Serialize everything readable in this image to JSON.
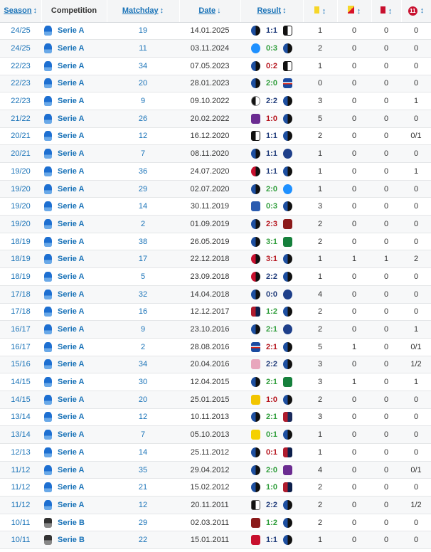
{
  "header": {
    "season": "Season",
    "competition": "Competition",
    "matchday": "Matchday",
    "date": "Date",
    "result": "Result",
    "sort_arrow": "↕",
    "sort_desc_arrow": "↓",
    "penalty_icon_label": "11"
  },
  "colors": {
    "link": "#1a73b8",
    "win": "#2e9d3a",
    "draw": "#1f3b7a",
    "loss": "#b5121b"
  },
  "rows": [
    {
      "season": "24/25",
      "competition": "Serie A",
      "matchday": "19",
      "date": "14.01.2025",
      "home": "atalanta-crest",
      "score": "1:1",
      "away": "juventus-crest",
      "outcome": "draw",
      "yellow": "1",
      "yellowred": "0",
      "red": "0",
      "penalties": "0"
    },
    {
      "season": "24/25",
      "competition": "Serie A",
      "matchday": "11",
      "date": "03.11.2024",
      "home": "napoli-crest",
      "score": "0:3",
      "away": "atalanta-crest",
      "outcome": "win",
      "yellow": "2",
      "yellowred": "0",
      "red": "0",
      "penalties": "0"
    },
    {
      "season": "22/23",
      "competition": "Serie A",
      "matchday": "34",
      "date": "07.05.2023",
      "home": "atalanta-crest",
      "score": "0:2",
      "away": "juventus-crest",
      "outcome": "loss",
      "yellow": "1",
      "yellowred": "0",
      "red": "0",
      "penalties": "0"
    },
    {
      "season": "22/23",
      "competition": "Serie A",
      "matchday": "20",
      "date": "28.01.2023",
      "home": "atalanta-crest",
      "score": "2:0",
      "away": "sampdoria-crest",
      "outcome": "win",
      "yellow": "0",
      "yellowred": "0",
      "red": "0",
      "penalties": "0"
    },
    {
      "season": "22/23",
      "competition": "Serie A",
      "matchday": "9",
      "date": "09.10.2022",
      "home": "udinese-crest",
      "score": "2:2",
      "away": "atalanta-crest",
      "outcome": "draw",
      "yellow": "3",
      "yellowred": "0",
      "red": "0",
      "penalties": "1"
    },
    {
      "season": "21/22",
      "competition": "Serie A",
      "matchday": "26",
      "date": "20.02.2022",
      "home": "fiorentina-crest",
      "score": "1:0",
      "away": "atalanta-crest",
      "outcome": "loss",
      "yellow": "5",
      "yellowred": "0",
      "red": "0",
      "penalties": "0"
    },
    {
      "season": "20/21",
      "competition": "Serie A",
      "matchday": "12",
      "date": "16.12.2020",
      "home": "juventus-crest",
      "score": "1:1",
      "away": "atalanta-crest",
      "outcome": "draw",
      "yellow": "2",
      "yellowred": "0",
      "red": "0",
      "penalties": "0/1"
    },
    {
      "season": "20/21",
      "competition": "Serie A",
      "matchday": "7",
      "date": "08.11.2020",
      "home": "atalanta-crest",
      "score": "1:1",
      "away": "inter-crest",
      "outcome": "draw",
      "yellow": "1",
      "yellowred": "0",
      "red": "0",
      "penalties": "0"
    },
    {
      "season": "19/20",
      "competition": "Serie A",
      "matchday": "36",
      "date": "24.07.2020",
      "home": "milan-crest",
      "score": "1:1",
      "away": "atalanta-crest",
      "outcome": "draw",
      "yellow": "1",
      "yellowred": "0",
      "red": "0",
      "penalties": "1"
    },
    {
      "season": "19/20",
      "competition": "Serie A",
      "matchday": "29",
      "date": "02.07.2020",
      "home": "atalanta-crest",
      "score": "2:0",
      "away": "napoli-crest",
      "outcome": "win",
      "yellow": "1",
      "yellowred": "0",
      "red": "0",
      "penalties": "0"
    },
    {
      "season": "19/20",
      "competition": "Serie A",
      "matchday": "14",
      "date": "30.11.2019",
      "home": "brescia-crest",
      "score": "0:3",
      "away": "atalanta-crest",
      "outcome": "win",
      "yellow": "3",
      "yellowred": "0",
      "red": "0",
      "penalties": "0"
    },
    {
      "season": "19/20",
      "competition": "Serie A",
      "matchday": "2",
      "date": "01.09.2019",
      "home": "atalanta-crest",
      "score": "2:3",
      "away": "torino-crest",
      "outcome": "loss",
      "yellow": "2",
      "yellowred": "0",
      "red": "0",
      "penalties": "0"
    },
    {
      "season": "18/19",
      "competition": "Serie A",
      "matchday": "38",
      "date": "26.05.2019",
      "home": "atalanta-crest",
      "score": "3:1",
      "away": "sassuolo-crest",
      "outcome": "win",
      "yellow": "2",
      "yellowred": "0",
      "red": "0",
      "penalties": "0"
    },
    {
      "season": "18/19",
      "competition": "Serie A",
      "matchday": "17",
      "date": "22.12.2018",
      "home": "milan-crest",
      "score": "3:1",
      "away": "atalanta-crest",
      "outcome": "loss",
      "yellow": "1",
      "yellowred": "1",
      "red": "1",
      "penalties": "2"
    },
    {
      "season": "18/19",
      "competition": "Serie A",
      "matchday": "5",
      "date": "23.09.2018",
      "home": "milan-crest",
      "score": "2:2",
      "away": "atalanta-crest",
      "outcome": "draw",
      "yellow": "1",
      "yellowred": "0",
      "red": "0",
      "penalties": "0"
    },
    {
      "season": "17/18",
      "competition": "Serie A",
      "matchday": "32",
      "date": "14.04.2018",
      "home": "atalanta-crest",
      "score": "0:0",
      "away": "inter-crest",
      "outcome": "draw",
      "yellow": "4",
      "yellowred": "0",
      "red": "0",
      "penalties": "0"
    },
    {
      "season": "17/18",
      "competition": "Serie A",
      "matchday": "16",
      "date": "12.12.2017",
      "home": "genoa-crest",
      "score": "1:2",
      "away": "atalanta-crest",
      "outcome": "win",
      "yellow": "2",
      "yellowred": "0",
      "red": "0",
      "penalties": "0"
    },
    {
      "season": "16/17",
      "competition": "Serie A",
      "matchday": "9",
      "date": "23.10.2016",
      "home": "atalanta-crest",
      "score": "2:1",
      "away": "inter-crest",
      "outcome": "win",
      "yellow": "2",
      "yellowred": "0",
      "red": "0",
      "penalties": "1"
    },
    {
      "season": "16/17",
      "competition": "Serie A",
      "matchday": "2",
      "date": "28.08.2016",
      "home": "sampdoria-crest",
      "score": "2:1",
      "away": "atalanta-crest",
      "outcome": "loss",
      "yellow": "5",
      "yellowred": "1",
      "red": "0",
      "penalties": "0/1"
    },
    {
      "season": "15/16",
      "competition": "Serie A",
      "matchday": "34",
      "date": "20.04.2016",
      "home": "palermo-crest",
      "score": "2:2",
      "away": "atalanta-crest",
      "outcome": "draw",
      "yellow": "3",
      "yellowred": "0",
      "red": "0",
      "penalties": "1/2"
    },
    {
      "season": "14/15",
      "competition": "Serie A",
      "matchday": "30",
      "date": "12.04.2015",
      "home": "atalanta-crest",
      "score": "2:1",
      "away": "sassuolo-crest",
      "outcome": "win",
      "yellow": "3",
      "yellowred": "1",
      "red": "0",
      "penalties": "1"
    },
    {
      "season": "14/15",
      "competition": "Serie A",
      "matchday": "20",
      "date": "25.01.2015",
      "home": "verona-crest",
      "score": "1:0",
      "away": "atalanta-crest",
      "outcome": "loss",
      "yellow": "2",
      "yellowred": "0",
      "red": "0",
      "penalties": "0"
    },
    {
      "season": "13/14",
      "competition": "Serie A",
      "matchday": "12",
      "date": "10.11.2013",
      "home": "atalanta-crest",
      "score": "2:1",
      "away": "bologna-crest",
      "outcome": "win",
      "yellow": "3",
      "yellowred": "0",
      "red": "0",
      "penalties": "0"
    },
    {
      "season": "13/14",
      "competition": "Serie A",
      "matchday": "7",
      "date": "05.10.2013",
      "home": "chievo-crest",
      "score": "0:1",
      "away": "atalanta-crest",
      "outcome": "win",
      "yellow": "1",
      "yellowred": "0",
      "red": "0",
      "penalties": "0"
    },
    {
      "season": "12/13",
      "competition": "Serie A",
      "matchday": "14",
      "date": "25.11.2012",
      "home": "atalanta-crest",
      "score": "0:1",
      "away": "genoa-crest",
      "outcome": "loss",
      "yellow": "1",
      "yellowred": "0",
      "red": "0",
      "penalties": "0"
    },
    {
      "season": "11/12",
      "competition": "Serie A",
      "matchday": "35",
      "date": "29.04.2012",
      "home": "atalanta-crest",
      "score": "2:0",
      "away": "fiorentina-crest",
      "outcome": "win",
      "yellow": "4",
      "yellowred": "0",
      "red": "0",
      "penalties": "0/1"
    },
    {
      "season": "11/12",
      "competition": "Serie A",
      "matchday": "21",
      "date": "15.02.2012",
      "home": "atalanta-crest",
      "score": "1:0",
      "away": "genoa-crest",
      "outcome": "win",
      "yellow": "2",
      "yellowred": "0",
      "red": "0",
      "penalties": "0"
    },
    {
      "season": "11/12",
      "competition": "Serie A",
      "matchday": "12",
      "date": "20.11.2011",
      "home": "cesena-crest",
      "score": "2:2",
      "away": "atalanta-crest",
      "outcome": "draw",
      "yellow": "2",
      "yellowred": "0",
      "red": "0",
      "penalties": "1/2"
    },
    {
      "season": "10/11",
      "competition": "Serie B",
      "matchday": "29",
      "date": "02.03.2011",
      "home": "torino-crest",
      "score": "1:2",
      "away": "atalanta-crest",
      "outcome": "win",
      "yellow": "2",
      "yellowred": "0",
      "red": "0",
      "penalties": "0"
    },
    {
      "season": "10/11",
      "competition": "Serie B",
      "matchday": "22",
      "date": "15.01.2011",
      "home": "varese-crest",
      "score": "1:1",
      "away": "atalanta-crest",
      "outcome": "draw",
      "yellow": "1",
      "yellowred": "0",
      "red": "0",
      "penalties": "0"
    }
  ]
}
